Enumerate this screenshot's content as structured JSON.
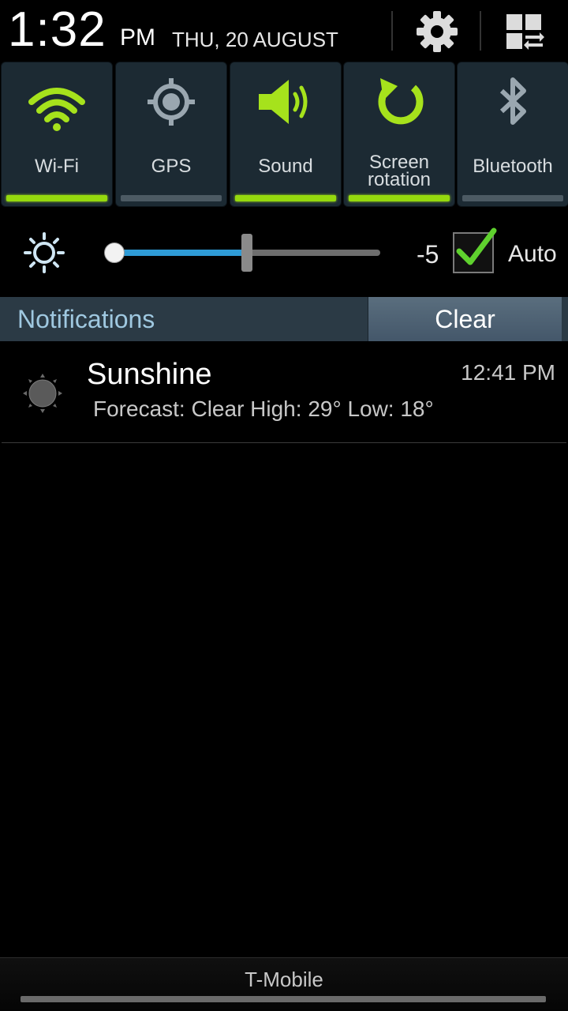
{
  "status_header": {
    "time": "1:32",
    "ampm": "PM",
    "date": "THU, 20 AUGUST",
    "settings_icon": "gear-icon",
    "quick_panel_icon": "grid-swap-icon"
  },
  "quick_toggles": [
    {
      "label": "Wi-Fi",
      "icon": "wifi-icon",
      "on": true
    },
    {
      "label": "GPS",
      "icon": "gps-icon",
      "on": false
    },
    {
      "label": "Sound",
      "icon": "speaker-icon",
      "on": true
    },
    {
      "label_line1": "Screen",
      "label_line2": "rotation",
      "icon": "rotation-icon",
      "on": true
    },
    {
      "label": "Bluetooth",
      "icon": "bluetooth-icon",
      "on": false
    }
  ],
  "brightness": {
    "icon": "brightness-icon",
    "value": "-5",
    "auto_label": "Auto",
    "auto_checked": true
  },
  "notifications": {
    "title": "Notifications",
    "clear_label": "Clear",
    "items": [
      {
        "app": "Sunshine",
        "time": "12:41 PM",
        "text": "Forecast: Clear High: 29° Low: 18°",
        "icon": "sun-icon"
      }
    ]
  },
  "footer": {
    "carrier": "T-Mobile"
  },
  "colors": {
    "toggle_on": "#95d90e",
    "toggle_bg": "#1c2a33",
    "slider_fill": "#2e9bd6",
    "notif_title": "#9fc8e0"
  }
}
